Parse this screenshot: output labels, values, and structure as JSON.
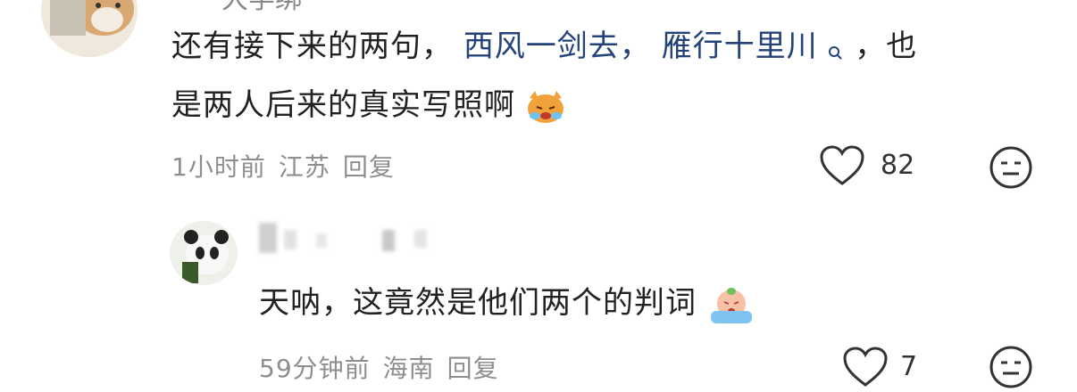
{
  "comment1": {
    "username_partial": "一大学绑",
    "text_before": "还有接下来的两句，",
    "link1": "西风一剑去，",
    "link2": "雁行十里川",
    "link_icon": "search-icon",
    "text_after1": "，也",
    "text_line2": "是两人后来的真实写照啊",
    "emoji": "crying-cat-emoji",
    "time": "1小时前",
    "location": "江苏",
    "reply": "回复",
    "like_count": "82",
    "like_icon": "heart-icon",
    "dislike_icon": "meh-face-icon"
  },
  "comment2": {
    "text": "天呐，这竟然是他们两个的判词",
    "emoji": "crying-face-emoji",
    "time": "59分钟前",
    "location": "海南",
    "reply": "回复",
    "like_count": "7",
    "like_icon": "heart-icon",
    "dislike_icon": "meh-face-icon"
  }
}
